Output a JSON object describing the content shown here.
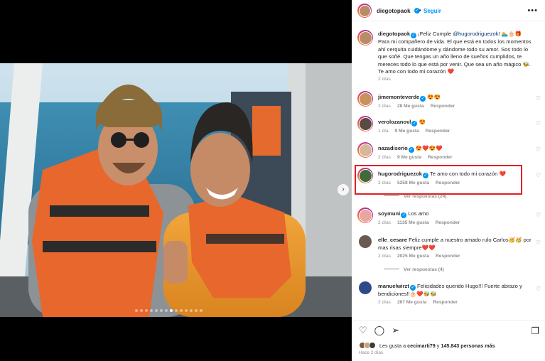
{
  "post": {
    "author": "diegotopaok",
    "follow_label": "Seguir",
    "caption_text": "¡Feliz Cumple",
    "caption_mention": "@hugorodriguezok",
    "caption_emojis_1": "! 🏊🎂🎁",
    "caption_rest": " Para mi compañero de vida. El que está en todos los momentos ahí cerquita cuidándome y dándome todo su amor. Sos todo lo que soñé. Que tengas un año lleno de sueños cumplidos, te mereces todo lo que está por venir. Que sea un año mágico 🐝. Te amo con todo mi corazón ❤️",
    "caption_time": "2 días",
    "more_icon": "more-horizontal-icon",
    "nav_icon": "chevron-right-icon"
  },
  "comments": [
    {
      "user": "jimemonteverde",
      "verified": true,
      "text": "😍😍",
      "time": "2 días",
      "likes": "28 Me gusta",
      "reply": "Responder"
    },
    {
      "user": "verolozanovl",
      "verified": true,
      "text": "😍",
      "time": "1 día",
      "likes": "9 Me gusta",
      "reply": "Responder"
    },
    {
      "user": "nazadiserio",
      "verified": true,
      "text": "😍❤️😍❤️",
      "time": "2 días",
      "likes": "9 Me gusta",
      "reply": "Responder"
    },
    {
      "user": "hugorodriguezok",
      "verified": true,
      "text": "Te amo con todo mi corazón ❤️",
      "time": "2 días",
      "likes": "5258 Me gusta",
      "reply": "Responder",
      "view_replies": "Ver respuestas (24)"
    },
    {
      "user": "soymuni",
      "verified": true,
      "text": "Los amo",
      "time": "2 días",
      "likes": "1135 Me gusta",
      "reply": "Responder"
    },
    {
      "user": "elle_cesare",
      "verified": false,
      "text": "Feliz cumple a nuestro amado rulo Carlos🥳🥳 por mas risas siempre❤️❤️",
      "time": "2 días",
      "likes": "2025 Me gusta",
      "reply": "Responder",
      "view_replies": "Ver respuestas (4)"
    },
    {
      "user": "manuelwirzt",
      "verified": true,
      "text": "Felicidades querido Hugo!!! Fuerte abrazo y bendiciones!!🎂❤️🐝🐝",
      "time": "2 días",
      "likes": "267 Me gusta",
      "reply": "Responder"
    }
  ],
  "footer": {
    "likes_prefix": "Les gusta a",
    "likes_user": "cecimarti79",
    "likes_mid": "y",
    "likes_count": "145.843 personas más",
    "ago": "Hace 2 días",
    "icons": [
      "heart-icon",
      "comment-icon",
      "share-icon",
      "bookmark-icon"
    ]
  },
  "colors": {
    "accent": "#0095f6",
    "highlight": "#e31e24",
    "text": "#262626",
    "muted": "#8e8e8e"
  }
}
